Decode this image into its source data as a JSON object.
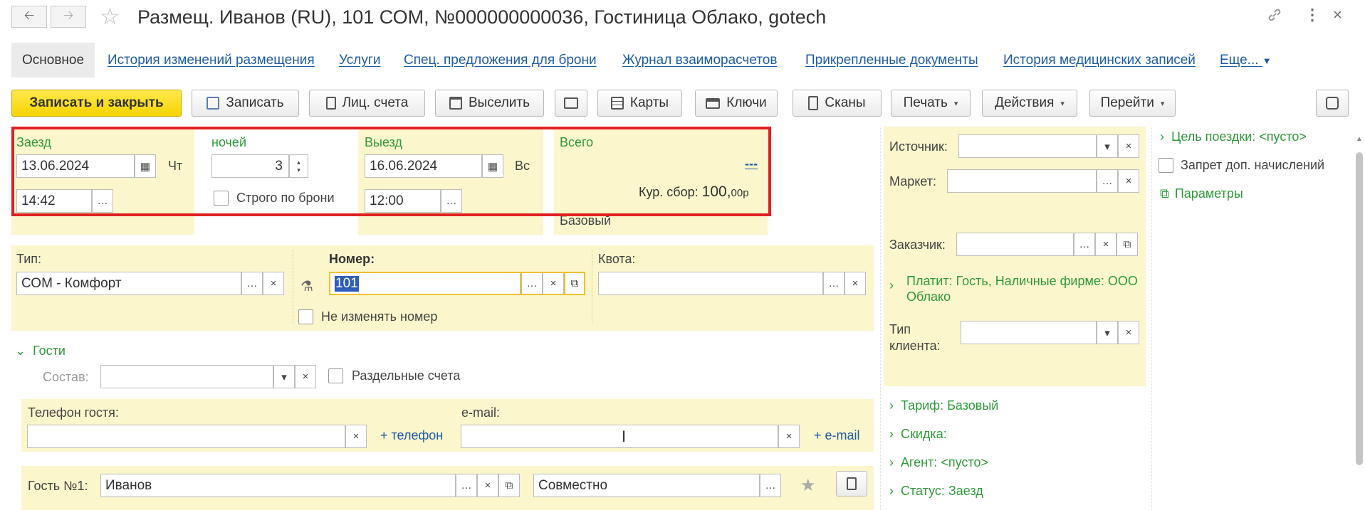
{
  "window": {
    "title": "Размещ. Иванов (RU), 101 СОМ, №000000000036, Гостиница Облако, gotech"
  },
  "tabs": [
    {
      "label": "Основное",
      "active": true
    },
    {
      "label": "История изменений размещения"
    },
    {
      "label": "Услуги"
    },
    {
      "label": "Спец. предложения для брони"
    },
    {
      "label": "Журнал взаиморасчетов"
    },
    {
      "label": "Прикрепленные документы"
    },
    {
      "label": "История медицинских записей"
    },
    {
      "label": "Еще..."
    }
  ],
  "toolbar": {
    "save_close": "Записать и закрыть",
    "save": "Записать",
    "accounts": "Лиц. счета",
    "checkout": "Выселить",
    "cards": "Карты",
    "keys": "Ключи",
    "scans": "Сканы",
    "print": "Печать",
    "actions": "Действия",
    "goto": "Перейти"
  },
  "checkin": {
    "label": "Заезд",
    "date": "13.06.2024",
    "weekday": "Чт",
    "time": "14:42"
  },
  "nights": {
    "label": "ночей",
    "value": "3",
    "strict_label": "Строго по брони"
  },
  "checkout_block": {
    "label": "Выезд",
    "date": "16.06.2024",
    "weekday": "Вс",
    "time": "12:00"
  },
  "total": {
    "label": "Всего",
    "dashes": "---",
    "tax_label": "Кур. сбор:",
    "tax_int": "100,",
    "tax_frac": "00р",
    "base_label": "Базовый"
  },
  "room": {
    "type_label": "Тип:",
    "type_value": "СОМ - Комфорт",
    "number_label": "Номер:",
    "number_value": "101",
    "quota_label": "Квота:",
    "quota_value": "",
    "keep_number_label": "Не изменять номер"
  },
  "guests": {
    "section_label": "Гости",
    "composition_label": "Состав:",
    "composition_value": "",
    "separate_label": "Раздельные счета",
    "phone_label": "Телефон гостя:",
    "phone_value": "",
    "add_phone": "+ телефон",
    "email_label": "e-mail:",
    "email_value": "",
    "add_email": "+ e-mail",
    "guest1_label": "Гость №1:",
    "guest1_value": "Иванов",
    "guest1_mode": "Совместно"
  },
  "right": {
    "source_label": "Источник:",
    "market_label": "Маркет:",
    "customer_label": "Заказчик:",
    "payer_text": "Платит: Гость, Наличные фирме: ООО Облако",
    "client_type_label": "Тип клиента:",
    "tariff": "Тариф: Базовый",
    "discount": "Скидка:",
    "agent": "Агент: <пусто>",
    "status": "Статус: Заезд"
  },
  "far_right": {
    "trip_goal": "Цель поездки: <пусто>",
    "no_extra_charges": "Запрет доп. начислений",
    "parameters": "Параметры"
  },
  "colors": {
    "accent_green": "#2f9a3a",
    "link_blue": "#1e5ba8",
    "panel_yellow": "#fbf6cc",
    "primary_yellow": "#f5d400",
    "highlight_red": "#e02020"
  }
}
